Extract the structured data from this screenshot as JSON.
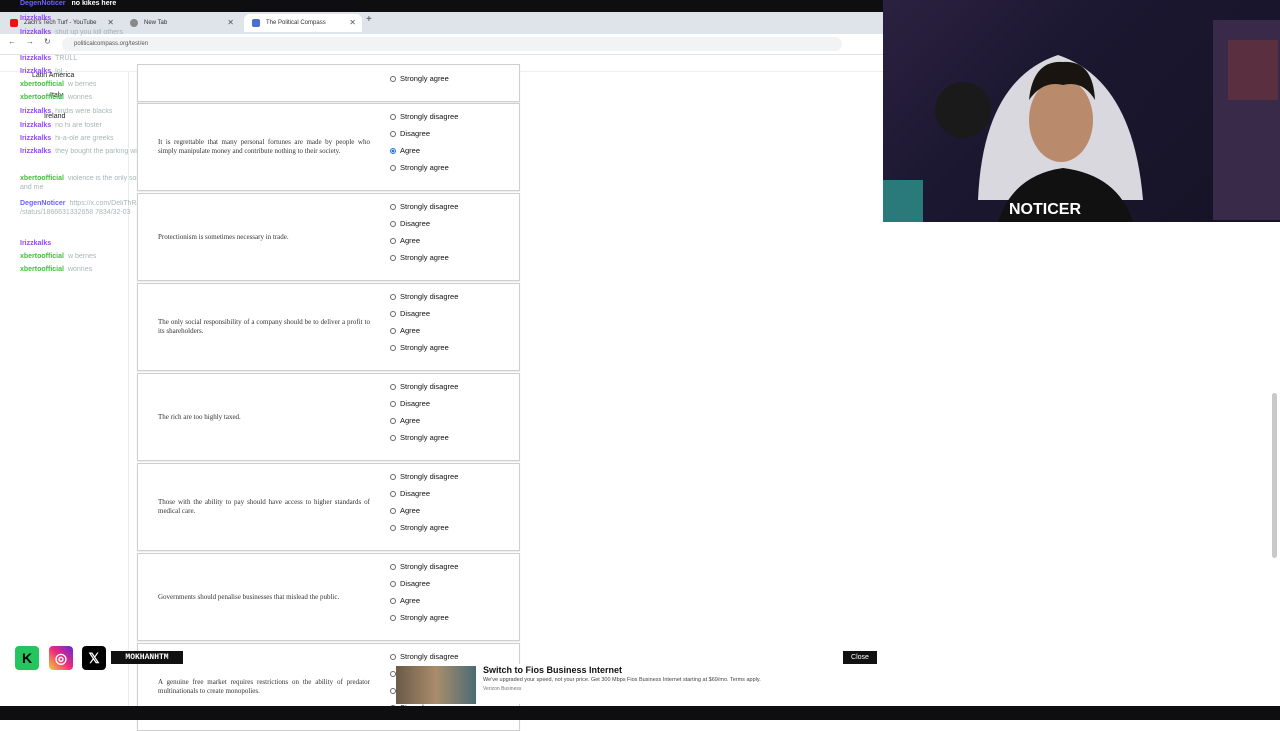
{
  "stream_chat_top": {
    "user": "DegenNoticer",
    "msg": "no kikes here"
  },
  "browser": {
    "tabs": [
      {
        "title": "Zach's Tech Turf - YouTube"
      },
      {
        "title": "New Tab"
      },
      {
        "title": "The Political Compass"
      }
    ],
    "url": "politicalcompass.org/test/en"
  },
  "sidebar": {
    "items": [
      "Latin America",
      "Italy",
      "Ireland"
    ]
  },
  "chat": [
    {
      "user": "Irizzkalks",
      "msg": "",
      "color": "#9146ff"
    },
    {
      "user": "Irizzkalks",
      "msg": "shut up you kill others",
      "color": "#9146ff"
    },
    {
      "user": "Irizzkalks",
      "msg": "TRULL",
      "color": "#9146ff"
    },
    {
      "user": "Irizzkalks",
      "msg": "lol",
      "color": "#9146ff"
    },
    {
      "user": "xbertoofficial",
      "msg": "w bernes",
      "color": "#3fbf3f"
    },
    {
      "user": "xbertoofficial",
      "msg": "wonnes",
      "color": "#3fbf3f"
    },
    {
      "user": "Irizzkalks",
      "msg": "hindis were blacks",
      "color": "#9146ff"
    },
    {
      "user": "Irizzkalks",
      "msg": "no hi are foster",
      "color": "#9146ff"
    },
    {
      "user": "Irizzkalks",
      "msg": "hi-a-ole are greeks",
      "color": "#9146ff"
    },
    {
      "user": "Irizzkalks",
      "msg": "they bought the parking with the world",
      "color": "#9146ff"
    },
    {
      "user": "xbertoofficial",
      "msg": "violence is the only solution soooo any and me",
      "color": "#3fbf3f"
    },
    {
      "user": "DegenNoticer",
      "msg": "https://x.com/DeliThRaybe /status/1866631332658 7834/32-03",
      "color": "#6b62ff"
    },
    {
      "user": "Irizzkalks",
      "msg": "",
      "color": "#9146ff"
    },
    {
      "user": "xbertoofficial",
      "msg": "w bernes",
      "color": "#3fbf3f"
    },
    {
      "user": "xbertoofficial",
      "msg": "wonnes",
      "color": "#3fbf3f"
    }
  ],
  "options_labels": [
    "Strongly disagree",
    "Disagree",
    "Agree",
    "Strongly agree"
  ],
  "questions": [
    {
      "text": "",
      "partial_option": "Strongly agree"
    },
    {
      "text": "It is regrettable that many personal fortunes are made by people who simply manipulate money and contribute nothing to their society.",
      "selected": "Agree"
    },
    {
      "text": "Protectionism is sometimes necessary in trade.",
      "selected": ""
    },
    {
      "text": "The only social responsibility of a company should be to deliver a profit to its shareholders.",
      "selected": ""
    },
    {
      "text": "The rich are too highly taxed.",
      "selected": ""
    },
    {
      "text": "Those with the ability to pay should have access to higher standards of medical care.",
      "selected": ""
    },
    {
      "text": "Governments should penalise businesses that mislead the public.",
      "selected": ""
    },
    {
      "text": "A genuine free market requires restrictions on the ability of predator multinationals to create monopolies.",
      "selected": ""
    }
  ],
  "ad": {
    "title": "Switch to Fios Business Internet",
    "body": "We've upgraded your speed, not your price. Get 300 Mbps Fios Business Internet starting at $69/mo. Terms apply.",
    "sponsor": "Verizon Business",
    "close": "Close"
  },
  "webcam": {
    "shirt_text": "NOTICER"
  },
  "socials": {
    "handle": "MOKHANHTM"
  },
  "colors": {
    "accent": "#1a73e8",
    "twitch_purple": "#9146ff",
    "chat_green": "#3fbf3f"
  }
}
